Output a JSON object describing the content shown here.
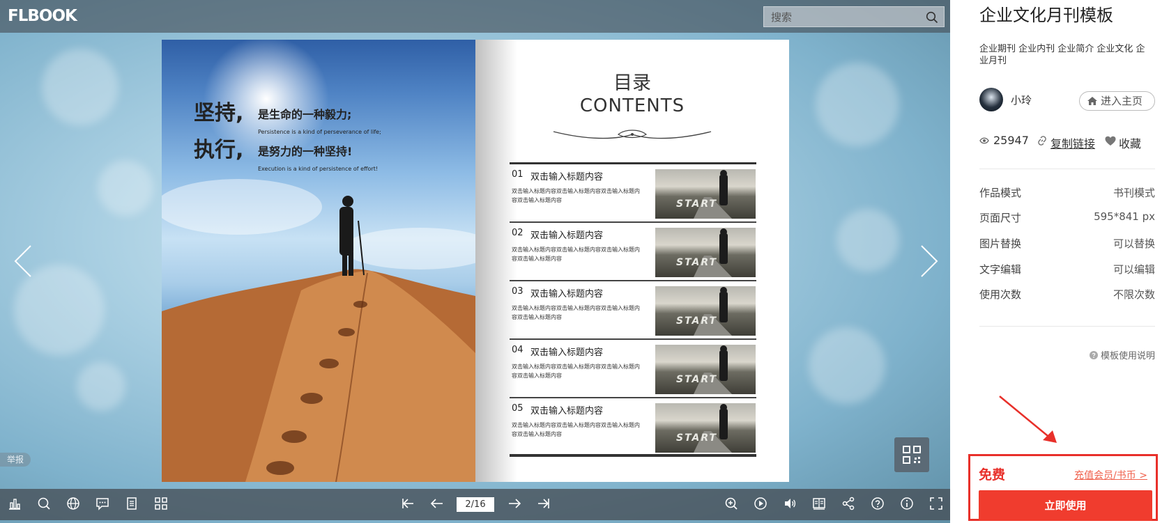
{
  "viewer": {
    "logo_text": "FLBOOK",
    "search_placeholder": "搜索",
    "report_label": "举报",
    "page_indicator": "2/16"
  },
  "book": {
    "left_page": {
      "line1_big": "坚持,",
      "line1_mid": "是生命的一种毅力;",
      "line1_small": "Persistence is a kind of perseverance of life;",
      "line2_big": "执行,",
      "line2_mid": "是努力的一种坚持!",
      "line2_small": "Execution is a kind of persistence of effort!"
    },
    "right_page": {
      "title_cn": "目录",
      "title_en": "CONTENTS",
      "items": [
        {
          "num": "01",
          "heading": "双击输入标题内容",
          "desc": "双击输入标题内容双击输入标题内容双击输入标题内容双击输入标题内容",
          "thumb_text": "START"
        },
        {
          "num": "02",
          "heading": "双击输入标题内容",
          "desc": "双击输入标题内容双击输入标题内容双击输入标题内容双击输入标题内容",
          "thumb_text": "START"
        },
        {
          "num": "03",
          "heading": "双击输入标题内容",
          "desc": "双击输入标题内容双击输入标题内容双击输入标题内容双击输入标题内容",
          "thumb_text": "START"
        },
        {
          "num": "04",
          "heading": "双击输入标题内容",
          "desc": "双击输入标题内容双击输入标题内容双击输入标题内容双击输入标题内容",
          "thumb_text": "START"
        },
        {
          "num": "05",
          "heading": "双击输入标题内容",
          "desc": "双击输入标题内容双击输入标题内容双击输入标题内容双击输入标题内容",
          "thumb_text": "START"
        }
      ]
    }
  },
  "sidebar": {
    "title": "企业文化月刊模板",
    "tags": "企业期刊 企业内刊 企业简介 企业文化 企业月刊",
    "author": "小玲",
    "home_label": "进入主页",
    "views": "25947",
    "copy_link": "复制链接",
    "favorite": "收藏",
    "attributes": [
      {
        "key": "作品模式",
        "value": "书刊模式"
      },
      {
        "key": "页面尺寸",
        "value": "595*841 px"
      },
      {
        "key": "图片替换",
        "value": "可以替换"
      },
      {
        "key": "文字编辑",
        "value": "可以编辑"
      },
      {
        "key": "使用次数",
        "value": "不限次数"
      }
    ],
    "help": "模板使用说明",
    "free_label": "免费",
    "recharge": "充值会员/书币 >",
    "use_button": "立即使用"
  },
  "colors": {
    "accent_red": "#f03c2e",
    "toolbar_bg": "#464e56"
  },
  "icons": [
    "search-icon",
    "chart-icon",
    "zoom-search-icon",
    "globe-icon",
    "comment-icon",
    "list-icon",
    "grid-icon",
    "first-page-icon",
    "prev-page-icon",
    "next-page-icon",
    "last-page-icon",
    "zoom-in-icon",
    "play-icon",
    "sound-icon",
    "book-mode-icon",
    "share-icon",
    "help-icon",
    "info-icon",
    "fullscreen-icon",
    "qr-code-icon",
    "home-icon",
    "eye-icon",
    "link-icon",
    "heart-icon"
  ]
}
